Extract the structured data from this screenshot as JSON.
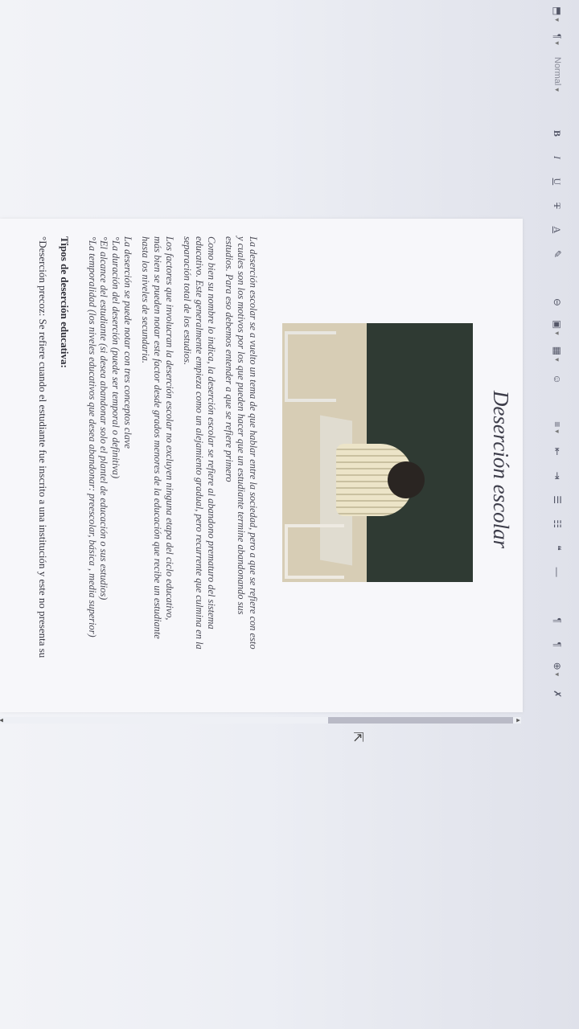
{
  "toolbar": {
    "style_label": "Normal",
    "bold": "B",
    "italic": "I",
    "underline": "U",
    "strike": "T",
    "font_color": "A",
    "highlight": "✎",
    "link": "⊖",
    "image": "▣",
    "table": "▦",
    "emoji": "☺",
    "align": "≡",
    "indent_left": "⇤",
    "indent_right": "⇥",
    "list_bullet": "☰",
    "list_number": "☷",
    "quote": "❝",
    "hr": "—",
    "ltr": "¶",
    "rtl": "¶",
    "globe": "⊕",
    "clear": "✗"
  },
  "document": {
    "title": "Deserción escolar",
    "p1": [
      "La deserción escolar se a vuelto un tema de que hablar entre la sociedad, pero a que se refiere con esto",
      "y cuales son los motivos por los que pueden hacer que un estudiante termine abandonando sus",
      "estudios. Para eso debemos entender a que se refiere primero"
    ],
    "p2": [
      "Como bien su nombre lo indica, la deserción escolar se refiere al abandono prematuro del sistema",
      "educativo. Este generalmente empieza como un alejamiento gradual, pero recurrente que culmina en la",
      "separación total de los estudios."
    ],
    "p3": [
      "Los factores que involucran la deserción escolar no excluyen ninguna etapa del ciclo educativo,",
      "más bien se pueden notar este factor desde grados menores de la educación que recibe un estudiante",
      "hasta los niveles de secundaria."
    ],
    "p4": [
      "La deserción se puede notar con tres conceptos clave",
      "°La duración del deserción (puede ser temporal o definitiva)",
      "°El alcance  del estudiante (si desea abandonar solo el plantel de educación o sus estudios)",
      "°La temporalidad (los niveles educativos que desea abandonar: preescolar, básica , media superior)"
    ],
    "types_heading": "Tipos de deserción educativa:",
    "type1": "°Deserción precoz: Se refiere cuando el estudiante fue inscrito a una institución y este no presenta su"
  },
  "colors": {
    "page": "#f7f7fa",
    "background": "#e9ebf2",
    "text": "#4a4a55"
  }
}
